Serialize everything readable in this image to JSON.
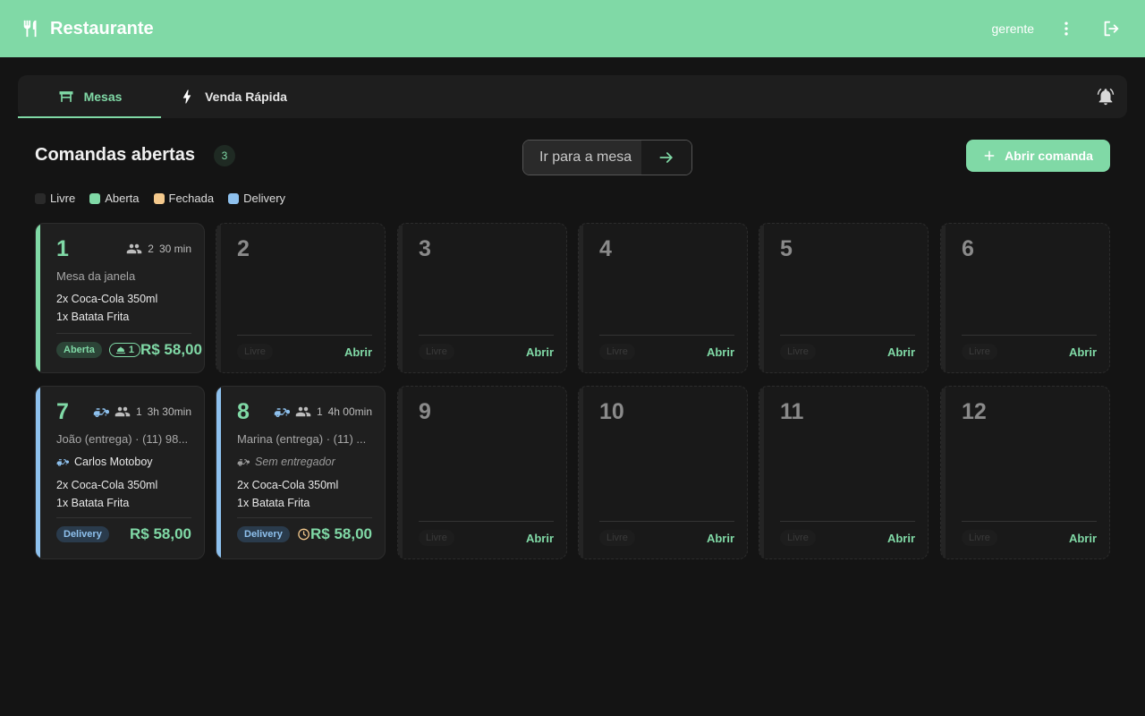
{
  "app": {
    "title": "Restaurante",
    "user": "gerente"
  },
  "tabs": [
    {
      "label": "Mesas",
      "active": true
    },
    {
      "label": "Venda Rápida",
      "active": false
    }
  ],
  "header": {
    "title": "Comandas abertas",
    "count": "3",
    "goto_placeholder": "Ir para a mesa",
    "open_button": "Abrir comanda"
  },
  "legend": [
    {
      "label": "Livre",
      "color": "#2a2a2a"
    },
    {
      "label": "Aberta",
      "color": "#80d9a6"
    },
    {
      "label": "Fechada",
      "color": "#f4c98c"
    },
    {
      "label": "Delivery",
      "color": "#8ec1ee"
    }
  ],
  "colors": {
    "accent": "#80d9a6",
    "delivery": "#8ec1ee",
    "clock": "#f4c98c"
  },
  "tables": {
    "t1": {
      "number": "1",
      "guests": "2",
      "time": "30 min",
      "desc": "Mesa da janela",
      "items": [
        "2x Coca-Cola 350ml",
        "1x Batata Frita"
      ],
      "status": "Aberta",
      "waiting": "1",
      "total": "R$ 58,00"
    },
    "t2": {
      "number": "2",
      "status": "Livre",
      "action": "Abrir"
    },
    "t3": {
      "number": "3",
      "status": "Livre",
      "action": "Abrir"
    },
    "t4": {
      "number": "4",
      "status": "Livre",
      "action": "Abrir"
    },
    "t5": {
      "number": "5",
      "status": "Livre",
      "action": "Abrir"
    },
    "t6": {
      "number": "6",
      "status": "Livre",
      "action": "Abrir"
    },
    "t7": {
      "number": "7",
      "guests": "1",
      "time": "3h 30min",
      "desc": "João (entrega) · (11) 98...",
      "courier": "Carlos Motoboy",
      "items": [
        "2x Coca-Cola 350ml",
        "1x Batata Frita"
      ],
      "status": "Delivery",
      "total": "R$ 58,00"
    },
    "t8": {
      "number": "8",
      "guests": "1",
      "time": "4h 00min",
      "desc": "Marina (entrega) · (11) ...",
      "courier": "Sem entregador",
      "items": [
        "2x Coca-Cola 350ml",
        "1x Batata Frita"
      ],
      "status": "Delivery",
      "total": "R$ 58,00"
    },
    "t9": {
      "number": "9",
      "status": "Livre",
      "action": "Abrir"
    },
    "t10": {
      "number": "10",
      "status": "Livre",
      "action": "Abrir"
    },
    "t11": {
      "number": "11",
      "status": "Livre",
      "action": "Abrir"
    },
    "t12": {
      "number": "12",
      "status": "Livre",
      "action": "Abrir"
    }
  }
}
